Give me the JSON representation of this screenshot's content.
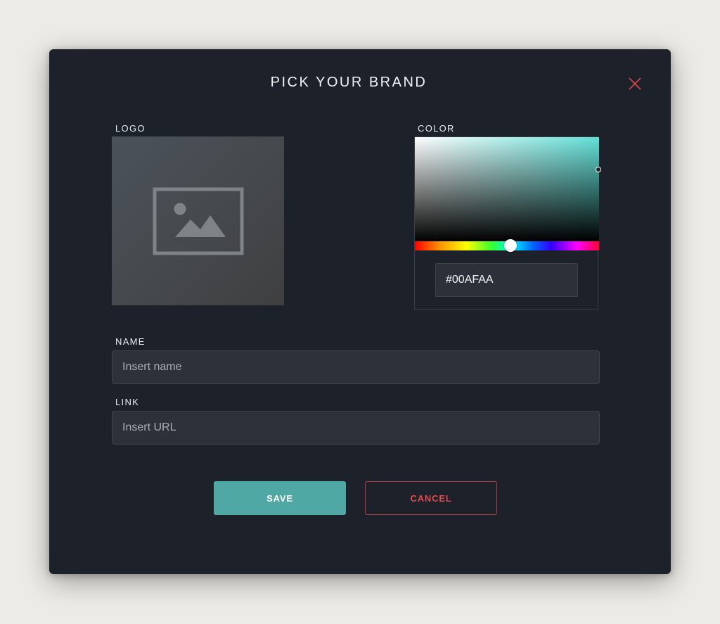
{
  "dialog": {
    "title": "PICK YOUR BRAND",
    "close_icon": "close-icon"
  },
  "logo": {
    "label": "LOGO",
    "placeholder_icon": "image-placeholder-icon"
  },
  "color": {
    "label": "COLOR",
    "hex_value": "#00AFAA",
    "picker_hue_color": "#63e0d7"
  },
  "name": {
    "label": "NAME",
    "placeholder": "Insert name",
    "value": ""
  },
  "link": {
    "label": "LINK",
    "placeholder": "Insert URL",
    "value": ""
  },
  "actions": {
    "save_label": "SAVE",
    "cancel_label": "CANCEL"
  },
  "colors": {
    "background": "#ecebe5",
    "dialog_bg": "#1d2129",
    "accent": "#4fa8a4",
    "danger": "#e04a4f"
  }
}
